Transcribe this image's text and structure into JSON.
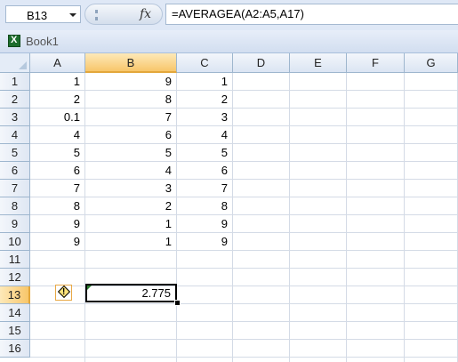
{
  "formula_bar": {
    "name_box": "B13",
    "fx_label": "fx",
    "formula": "=AVERAGEA(A2:A5,A17)"
  },
  "workbook": {
    "title": "Book1"
  },
  "columns": [
    "A",
    "B",
    "C",
    "D",
    "E",
    "F",
    "G"
  ],
  "rows": [
    "1",
    "2",
    "3",
    "4",
    "5",
    "6",
    "7",
    "8",
    "9",
    "10",
    "11",
    "12",
    "13",
    "14",
    "15",
    "16"
  ],
  "active_cell": {
    "column": "B",
    "row": "13",
    "value": "2.775"
  },
  "cells": {
    "A": [
      "1",
      "2",
      "0.1",
      "4",
      "5",
      "6",
      "7",
      "8",
      "9",
      "9"
    ],
    "B": [
      "9",
      "8",
      "7",
      "6",
      "5",
      "4",
      "3",
      "2",
      "1",
      "1"
    ],
    "C": [
      "1",
      "2",
      "3",
      "4",
      "5",
      "6",
      "7",
      "8",
      "9",
      "9"
    ]
  },
  "colors": {
    "header_active": "#f8c66a",
    "grid_line": "#d4dbe6",
    "formula_bar_bg": "#dfe8f6"
  }
}
